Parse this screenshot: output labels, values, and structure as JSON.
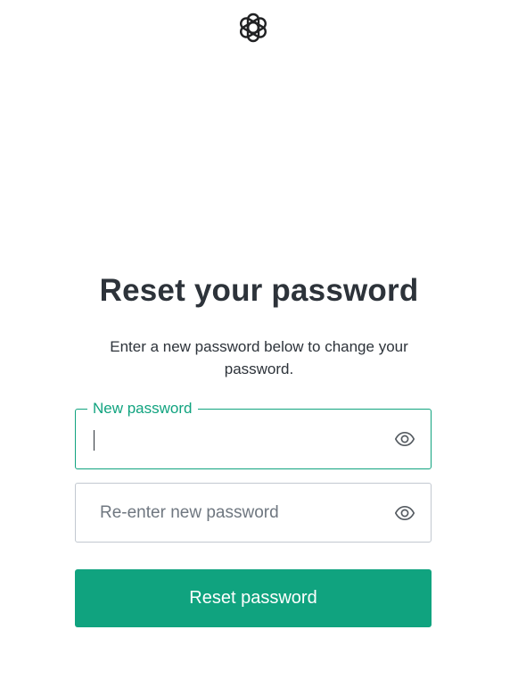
{
  "logo": {
    "icon": "openai-logo-icon"
  },
  "heading": {
    "title": "Reset your password"
  },
  "description": {
    "text": "Enter a new password below to change your password."
  },
  "form": {
    "new_password": {
      "label": "New password",
      "value": "",
      "icon": "eye-icon"
    },
    "reenter_password": {
      "placeholder": "Re-enter new password",
      "value": "",
      "icon": "eye-icon"
    },
    "submit_label": "Reset password"
  },
  "colors": {
    "accent": "#10a37f",
    "text": "#2d333a",
    "border": "#c2c8d0",
    "placeholder": "#6f7780",
    "background": "#ffffff"
  }
}
